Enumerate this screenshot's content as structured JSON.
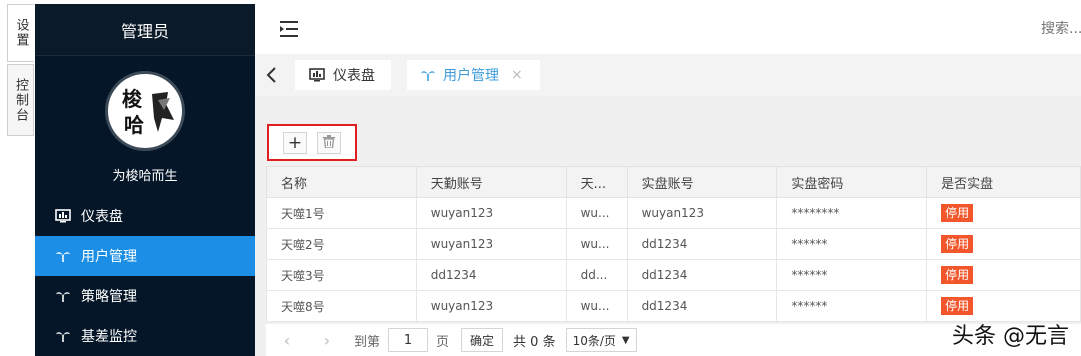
{
  "side_tabs": [
    "设置",
    "控制台"
  ],
  "sidebar": {
    "header": "管理员",
    "avatar_text": "梭哈",
    "slogan": "为梭哈而生",
    "items": [
      {
        "label": "仪表盘",
        "icon": "dashboard-icon"
      },
      {
        "label": "用户管理",
        "icon": "palm-icon"
      },
      {
        "label": "策略管理",
        "icon": "palm-icon"
      },
      {
        "label": "基差监控",
        "icon": "palm-icon"
      }
    ]
  },
  "topbar": {
    "menu_icon": "indent-icon",
    "search_placeholder": "搜索..."
  },
  "tabs": [
    {
      "label": "仪表盘",
      "icon": "dashboard-icon"
    },
    {
      "label": "用户管理",
      "icon": "palm-icon",
      "close": "×"
    }
  ],
  "toolbar": {
    "add": "+",
    "delete_icon": "trash-icon"
  },
  "table": {
    "headers": [
      "名称",
      "天勤账号",
      "天...",
      "实盘账号",
      "实盘密码",
      "是否实盘"
    ],
    "rows": [
      [
        "天噬1号",
        "wuyan123",
        "wu...",
        "wuyan123",
        "********",
        "停用"
      ],
      [
        "天噬2号",
        "wuyan123",
        "wu...",
        "dd1234",
        "******",
        "停用"
      ],
      [
        "天噬3号",
        "dd1234",
        "dd...",
        "dd1234",
        "******",
        "停用"
      ],
      [
        "天噬8号",
        "wuyan123",
        "wu...",
        "dd1234",
        "******",
        "停用"
      ]
    ]
  },
  "pager": {
    "prev": "‹",
    "next": "›",
    "goto": "到第",
    "page_value": "1",
    "page_unit": "页",
    "confirm": "确定",
    "total": "共 0 条",
    "page_size": "10条/页"
  },
  "watermark": "头条 @无言",
  "colors": {
    "sidebar_bg": "#041627",
    "active_item": "#1c8ee6",
    "badge": "#f2562a",
    "highlight_border": "#e02020"
  }
}
